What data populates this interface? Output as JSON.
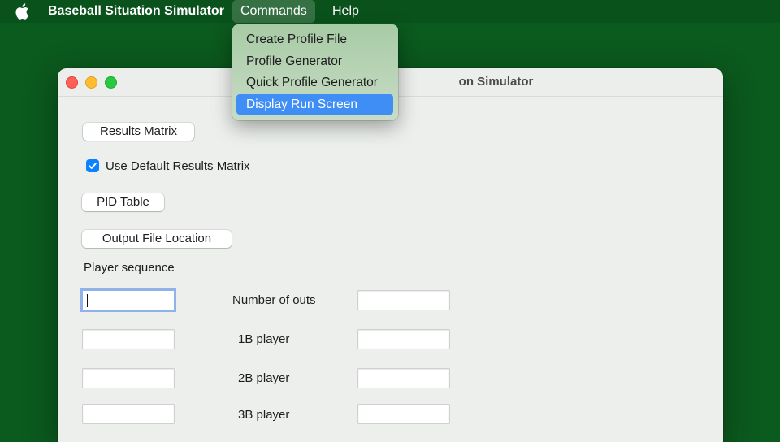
{
  "menubar": {
    "apple_icon": "apple-logo-icon",
    "app_name": "Baseball Situation Simulator",
    "menus": [
      "Commands",
      "Help"
    ],
    "active_menu": "Commands"
  },
  "window": {
    "title_visible": "on Simulator",
    "results_matrix_button": "Results Matrix",
    "use_default_checkbox": {
      "label": "Use Default Results Matrix",
      "checked": true
    },
    "pid_table_button": "PID Table",
    "output_location_button": "Output File Location",
    "player_sequence_label": "Player sequence",
    "situation_labels": [
      "Number of outs",
      "1B player",
      "2B player",
      "3B player"
    ],
    "player_fields": [
      "",
      "",
      "",
      ""
    ],
    "situation_fields": [
      "",
      "",
      "",
      ""
    ]
  },
  "commands_menu": {
    "items": [
      "Create Profile File",
      "Profile Generator",
      "Quick Profile Generator",
      "Display Run Screen"
    ],
    "highlighted": "Display Run Screen"
  },
  "colors": {
    "desktop": "#0b5a1e",
    "highlight": "#3f8ef5",
    "checkbox": "#0a82ff"
  }
}
